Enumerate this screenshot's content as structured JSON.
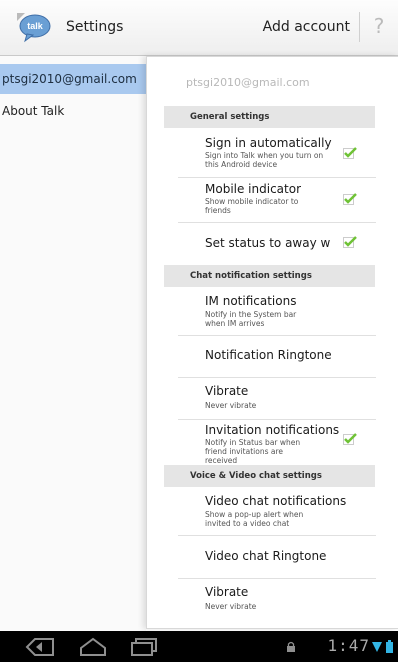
{
  "actionbar": {
    "app_icon_label": "talk",
    "title": "Settings",
    "add_account": "Add account"
  },
  "accounts": [
    {
      "label": "ptsgi2010@gmail.com",
      "selected": true
    },
    {
      "label": "About Talk",
      "selected": false
    }
  ],
  "account_header": "ptsgi2010@gmail.com",
  "sections": [
    {
      "title": "General settings"
    },
    {
      "title": "Chat notification settings"
    },
    {
      "title": "Voice & Video chat settings"
    }
  ],
  "settings": [
    {
      "title": "Sign in automatically",
      "summary": "Sign into Talk when you turn on this Android device",
      "checked": true
    },
    {
      "title": "Mobile indicator",
      "summary": "Show mobile indicator to friends",
      "checked": true
    },
    {
      "title": "Set status to away whe",
      "summary": "",
      "checked": true
    },
    {
      "title": "IM notifications",
      "summary": "Notify in the System bar when IM arrives"
    },
    {
      "title": "Notification Ringtone",
      "summary": ""
    },
    {
      "title": "Vibrate",
      "summary": "Never vibrate"
    },
    {
      "title": "Invitation notifications",
      "summary": "Notify in Status bar when friend invitations are received",
      "checked": true
    },
    {
      "title": "Video chat notifications",
      "summary": "Show a pop-up alert when invited to a video chat"
    },
    {
      "title": "Video chat Ringtone",
      "summary": ""
    },
    {
      "title": "Vibrate",
      "summary": "Never vibrate"
    }
  ],
  "statusbar": {
    "time": "1:47"
  },
  "colors": {
    "selected_bg": "#a9c9ef",
    "check_green": "#6fc236",
    "section_bg": "#e5e5e5"
  }
}
